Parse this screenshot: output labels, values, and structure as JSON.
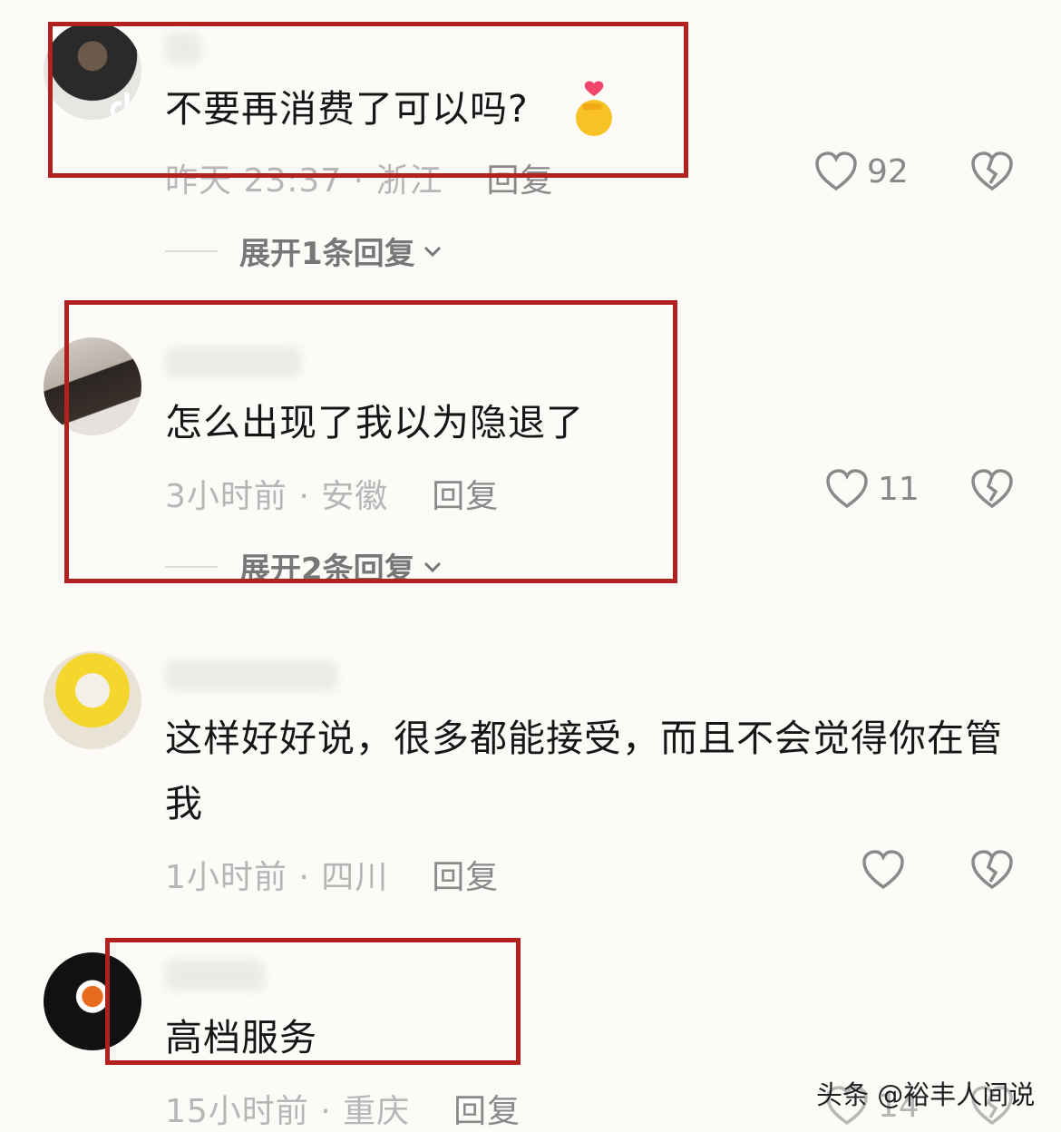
{
  "comments": [
    {
      "username": "",
      "text": "不要再消费了可以吗?",
      "time_location": "昨天 23:37 · 浙江",
      "reply_label": "回复",
      "likes": "92",
      "expand_label": "展开1条回复"
    },
    {
      "username": "",
      "text": "怎么出现了我以为隐退了",
      "time_location": "3小时前 · 安徽",
      "reply_label": "回复",
      "likes": "11",
      "expand_label": "展开2条回复"
    },
    {
      "username": "",
      "text": "这样好好说，很多都能接受，而且不会觉得你在管我",
      "time_location": "1小时前 · 四川",
      "reply_label": "回复",
      "likes": ""
    },
    {
      "username": "",
      "text": "高档服务",
      "time_location": "15小时前 · 重庆",
      "reply_label": "回复",
      "likes": "14"
    }
  ],
  "watermark": "头条 @裕丰人间说",
  "icons": [
    "heart-icon",
    "broken-heart-icon",
    "chevron-down-icon",
    "finger-heart-emoji-icon"
  ],
  "colors": {
    "highlight_box": "#b3211e",
    "meta_text": "#b6b6b6",
    "background": "#fcfbf8"
  }
}
